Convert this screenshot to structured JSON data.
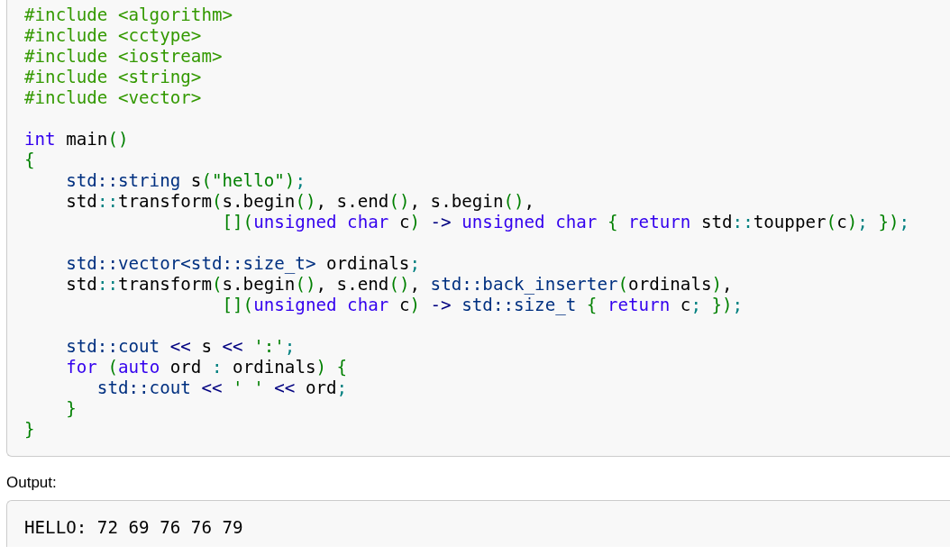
{
  "code": {
    "lines": [
      {
        "tokens": [
          {
            "text": "#include <algorithm>",
            "kind": "preprocessor"
          }
        ]
      },
      {
        "tokens": [
          {
            "text": "#include <cctype>",
            "kind": "preprocessor"
          }
        ]
      },
      {
        "tokens": [
          {
            "text": "#include <iostream>",
            "kind": "preprocessor"
          }
        ]
      },
      {
        "tokens": [
          {
            "text": "#include <string>",
            "kind": "preprocessor"
          }
        ]
      },
      {
        "tokens": [
          {
            "text": "#include <vector>",
            "kind": "preprocessor"
          }
        ]
      },
      {
        "space_before": true,
        "tokens": [
          {
            "text": "int",
            "kind": "keyword"
          },
          {
            "text": " main",
            "kind": "plain"
          },
          {
            "text": "()",
            "kind": "bracket"
          }
        ]
      },
      {
        "tokens": [
          {
            "text": "{",
            "kind": "bracket"
          }
        ]
      },
      {
        "tokens": [
          {
            "text": "    std::string",
            "kind": "type"
          },
          {
            "text": " s",
            "kind": "plain"
          },
          {
            "text": "(",
            "kind": "bracket"
          },
          {
            "text": "\"hello\"",
            "kind": "string"
          },
          {
            "text": ")",
            "kind": "bracket"
          },
          {
            "text": ";",
            "kind": "symbol"
          }
        ]
      },
      {
        "tokens": [
          {
            "text": "    std",
            "kind": "plain"
          },
          {
            "text": "::",
            "kind": "symbol"
          },
          {
            "text": "transform",
            "kind": "plain"
          },
          {
            "text": "(",
            "kind": "bracket"
          },
          {
            "text": "s.begin",
            "kind": "plain"
          },
          {
            "text": "()",
            "kind": "bracket"
          },
          {
            "text": ", s.end",
            "kind": "plain"
          },
          {
            "text": "()",
            "kind": "bracket"
          },
          {
            "text": ", s.begin",
            "kind": "plain"
          },
          {
            "text": "()",
            "kind": "bracket"
          },
          {
            "text": ",",
            "kind": "plain"
          }
        ]
      },
      {
        "tokens": [
          {
            "text": "                   [](",
            "kind": "bracket"
          },
          {
            "text": "unsigned char",
            "kind": "keyword"
          },
          {
            "text": " c",
            "kind": "plain"
          },
          {
            "text": ")",
            "kind": "bracket"
          },
          {
            "text": " ->",
            "kind": "operator"
          },
          {
            "text": " unsigned char",
            "kind": "keyword"
          },
          {
            "text": " {",
            "kind": "bracket"
          },
          {
            "text": " return",
            "kind": "keyword"
          },
          {
            "text": " std",
            "kind": "plain"
          },
          {
            "text": "::",
            "kind": "symbol"
          },
          {
            "text": "toupper",
            "kind": "plain"
          },
          {
            "text": "(",
            "kind": "bracket"
          },
          {
            "text": "c",
            "kind": "plain"
          },
          {
            "text": ")",
            "kind": "bracket"
          },
          {
            "text": ";",
            "kind": "symbol"
          },
          {
            "text": " })",
            "kind": "bracket"
          },
          {
            "text": ";",
            "kind": "symbol"
          }
        ]
      },
      {
        "space_before": true,
        "tokens": [
          {
            "text": "    std::vector<std::size_t>",
            "kind": "type"
          },
          {
            "text": " ordinals",
            "kind": "plain"
          },
          {
            "text": ";",
            "kind": "symbol"
          }
        ]
      },
      {
        "tokens": [
          {
            "text": "    std",
            "kind": "plain"
          },
          {
            "text": "::",
            "kind": "symbol"
          },
          {
            "text": "transform",
            "kind": "plain"
          },
          {
            "text": "(",
            "kind": "bracket"
          },
          {
            "text": "s.begin",
            "kind": "plain"
          },
          {
            "text": "()",
            "kind": "bracket"
          },
          {
            "text": ", s.end",
            "kind": "plain"
          },
          {
            "text": "()",
            "kind": "bracket"
          },
          {
            "text": ", ",
            "kind": "plain"
          },
          {
            "text": "std::back_inserter",
            "kind": "type"
          },
          {
            "text": "(",
            "kind": "bracket"
          },
          {
            "text": "ordinals",
            "kind": "plain"
          },
          {
            "text": ")",
            "kind": "bracket"
          },
          {
            "text": ",",
            "kind": "plain"
          }
        ]
      },
      {
        "tokens": [
          {
            "text": "                   [](",
            "kind": "bracket"
          },
          {
            "text": "unsigned char",
            "kind": "keyword"
          },
          {
            "text": " c",
            "kind": "plain"
          },
          {
            "text": ")",
            "kind": "bracket"
          },
          {
            "text": " ->",
            "kind": "operator"
          },
          {
            "text": " std::size_t",
            "kind": "type"
          },
          {
            "text": " {",
            "kind": "bracket"
          },
          {
            "text": " return",
            "kind": "keyword"
          },
          {
            "text": " c",
            "kind": "plain"
          },
          {
            "text": ";",
            "kind": "symbol"
          },
          {
            "text": " })",
            "kind": "bracket"
          },
          {
            "text": ";",
            "kind": "symbol"
          }
        ]
      },
      {
        "space_before": true,
        "tokens": [
          {
            "text": "    std::cout",
            "kind": "type"
          },
          {
            "text": " <<",
            "kind": "operator"
          },
          {
            "text": " s",
            "kind": "plain"
          },
          {
            "text": " <<",
            "kind": "operator"
          },
          {
            "text": " ':'",
            "kind": "string"
          },
          {
            "text": ";",
            "kind": "symbol"
          }
        ]
      },
      {
        "tokens": [
          {
            "text": "    for",
            "kind": "keyword"
          },
          {
            "text": " (",
            "kind": "bracket"
          },
          {
            "text": "auto",
            "kind": "keyword"
          },
          {
            "text": " ord",
            "kind": "plain"
          },
          {
            "text": " :",
            "kind": "symbol"
          },
          {
            "text": " ordinals",
            "kind": "plain"
          },
          {
            "text": ")",
            "kind": "bracket"
          },
          {
            "text": " {",
            "kind": "bracket"
          }
        ]
      },
      {
        "tokens": [
          {
            "text": "       std::cout",
            "kind": "type"
          },
          {
            "text": " <<",
            "kind": "operator"
          },
          {
            "text": " ' '",
            "kind": "string"
          },
          {
            "text": " <<",
            "kind": "operator"
          },
          {
            "text": " ord",
            "kind": "plain"
          },
          {
            "text": ";",
            "kind": "symbol"
          }
        ]
      },
      {
        "tokens": [
          {
            "text": "    }",
            "kind": "bracket"
          }
        ]
      },
      {
        "tokens": [
          {
            "text": "}",
            "kind": "bracket"
          }
        ]
      }
    ]
  },
  "output": {
    "label": "Output:",
    "text": "HELLO: 72 69 76 76 79"
  }
}
